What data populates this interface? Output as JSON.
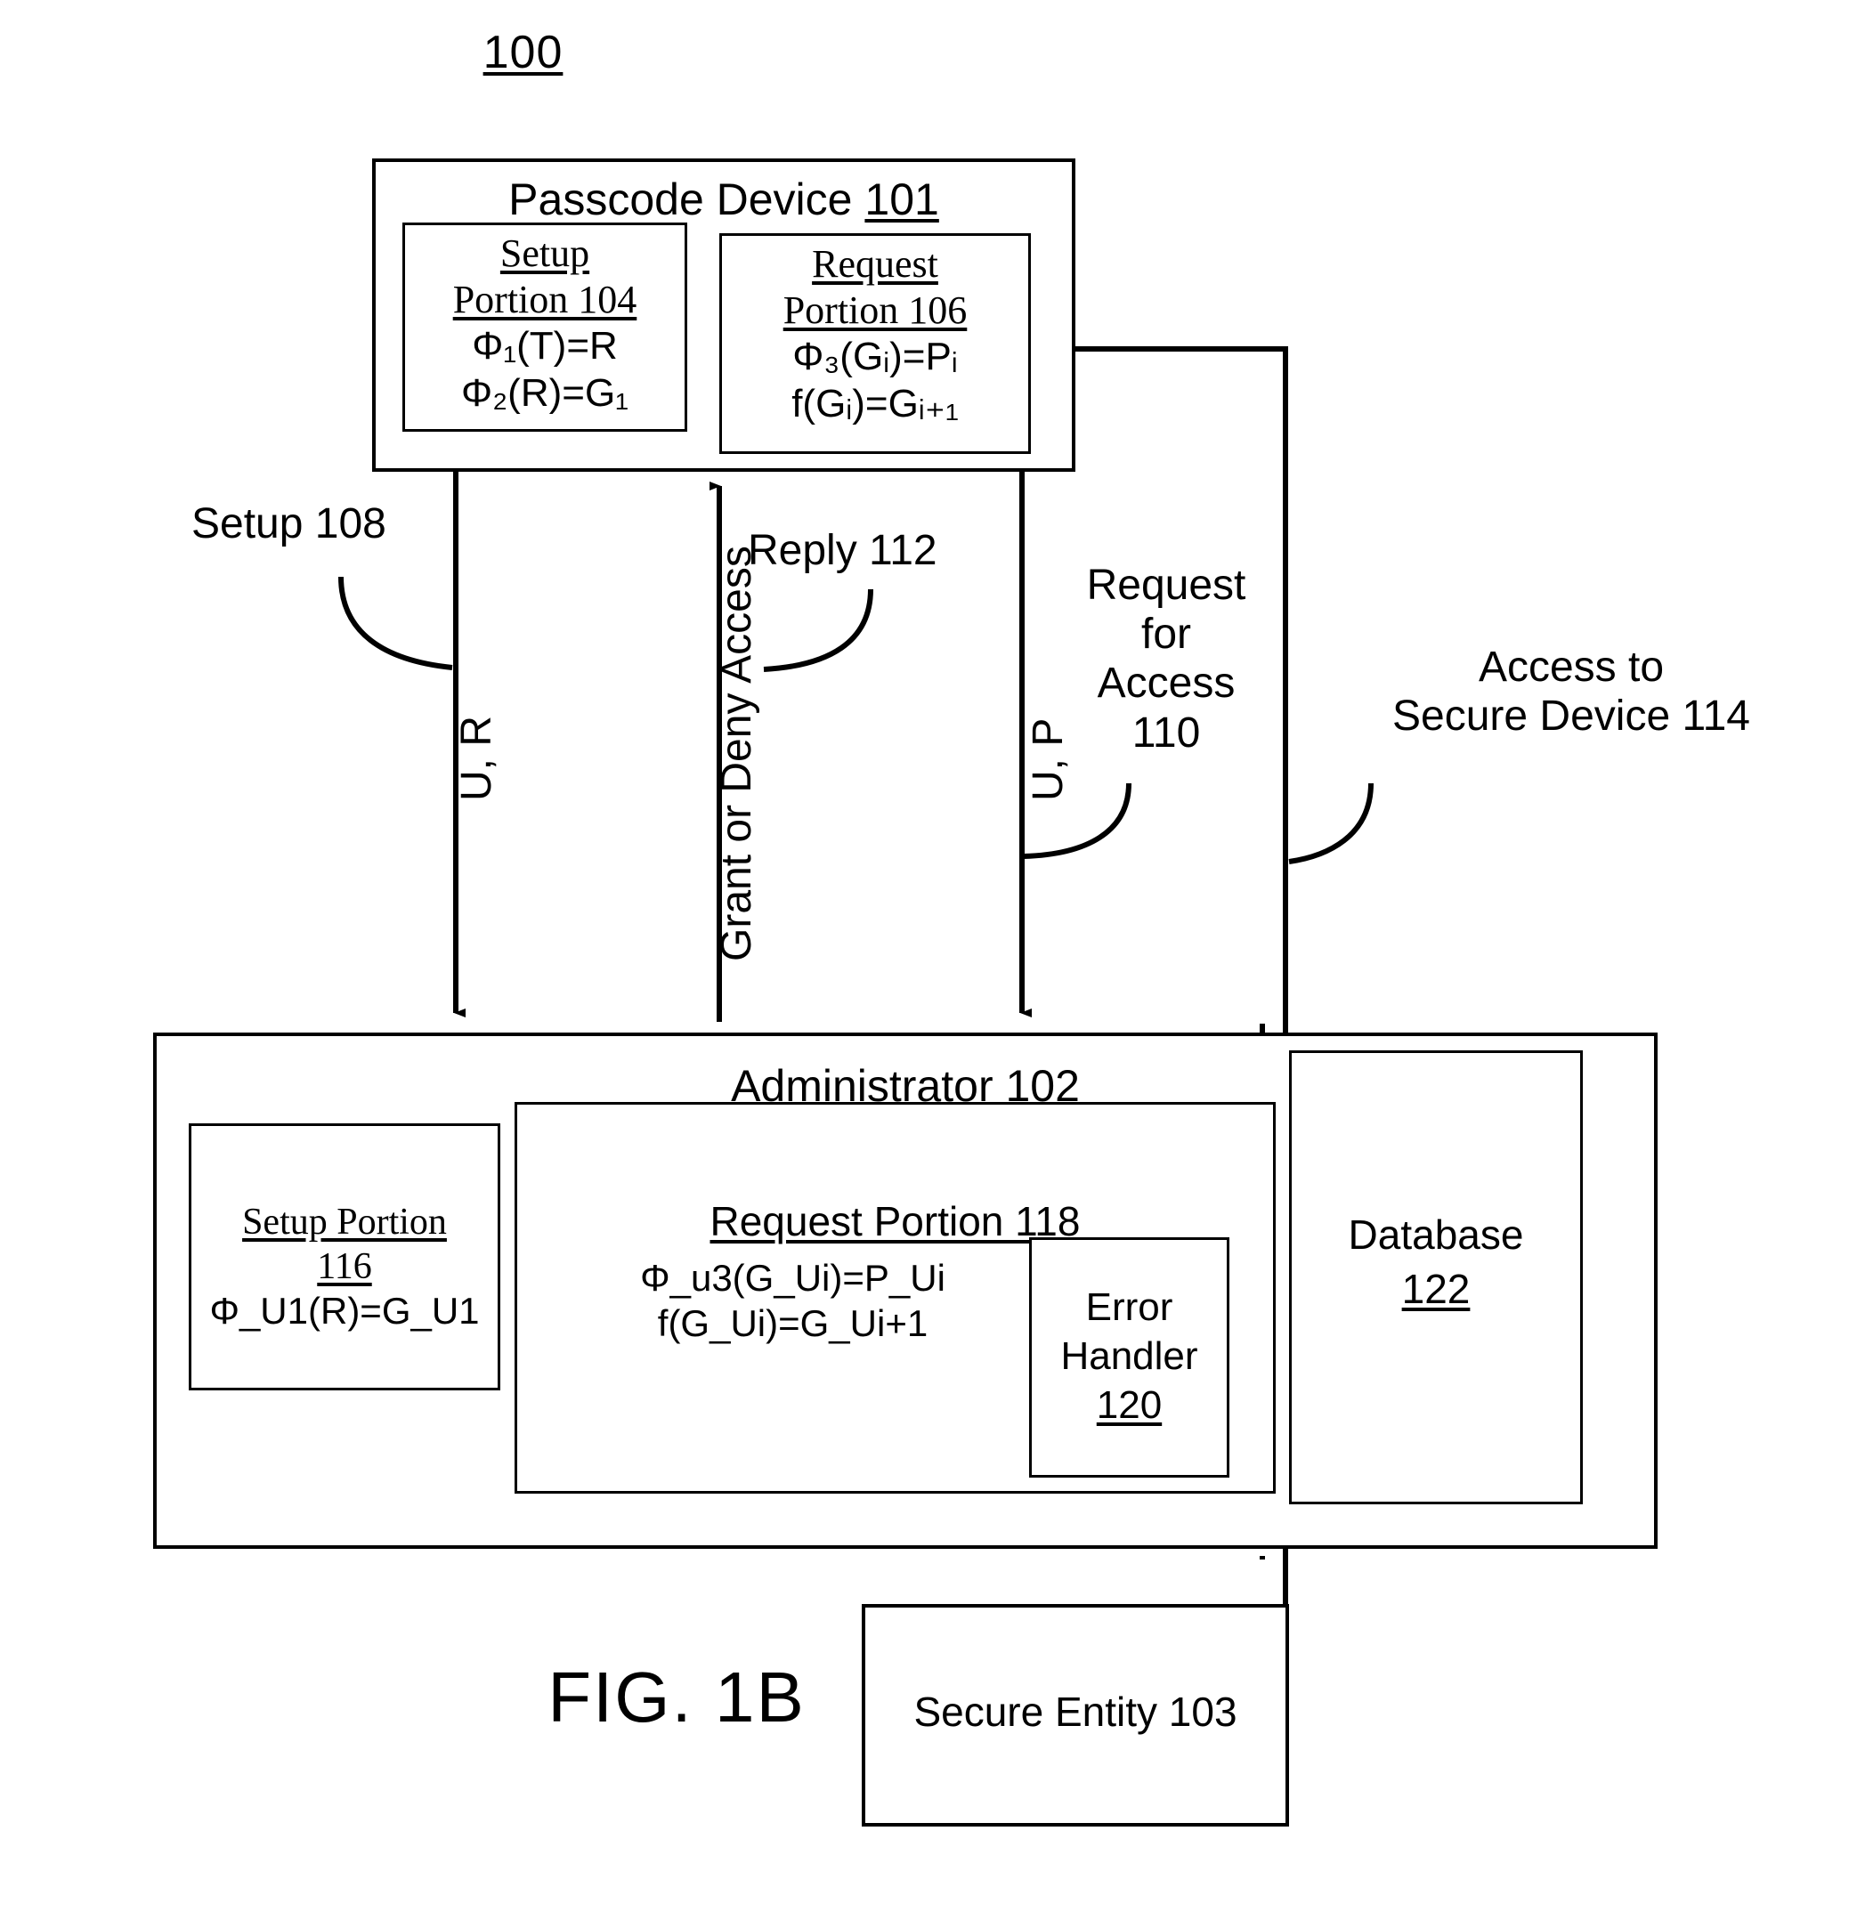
{
  "figure": {
    "number": "100",
    "caption": "FIG. 1B"
  },
  "passcode_device": {
    "title": "Passcode Device",
    "ref": "101",
    "setup_portion": {
      "head_line1": "Setup",
      "head_line2": "Portion 104",
      "formula1": "Φ₁(T)=R",
      "formula2": "Φ₂(R)=G₁",
      "f1_base": "Φ",
      "f1_sub": "1",
      "f1_rest": "(T)=R",
      "f2_base": "Φ",
      "f2_sub": "2",
      "f2_rest_a": "(R)=G",
      "f2_sub_b": "1"
    },
    "request_portion": {
      "head_line1": "Request",
      "head_line2": "Portion 106",
      "formula1": "Φ₃(Gᵢ)=Pᵢ",
      "formula2": "f(Gᵢ)=Gᵢ₊₁"
    }
  },
  "administrator": {
    "title": "Administrator",
    "ref": "102",
    "setup_portion": {
      "head_line1": "Setup Portion",
      "head_line2": "116",
      "formula1": "Φ_U1(R)=G_U1"
    },
    "request_portion": {
      "head": "Request Portion 118",
      "formula1": "Φ_u3(G_Ui)=P_Ui",
      "formula2": "f(G_Ui)=G_Ui+1"
    },
    "error_handler": {
      "line1": "Error",
      "line2": "Handler",
      "ref": "120"
    },
    "database": {
      "line1": "Database",
      "ref": "122"
    }
  },
  "secure_entity": {
    "label": "Secure Entity 103"
  },
  "flow_labels": {
    "setup": "Setup 108",
    "setup_payload": "U, R",
    "reply": "Reply 112",
    "grant_deny": "Grant or Deny Access",
    "request_payload": "U, P",
    "request_for_access": "Request\nfor\nAccess\n110",
    "request_for_access_l1": "Request",
    "request_for_access_l2": "for",
    "request_for_access_l3": "Access",
    "request_for_access_l4": "110",
    "access_secure_l1": "Access to",
    "access_secure_l2": "Secure Device 114"
  },
  "colors": {
    "ink": "#000000",
    "paper": "#ffffff"
  }
}
